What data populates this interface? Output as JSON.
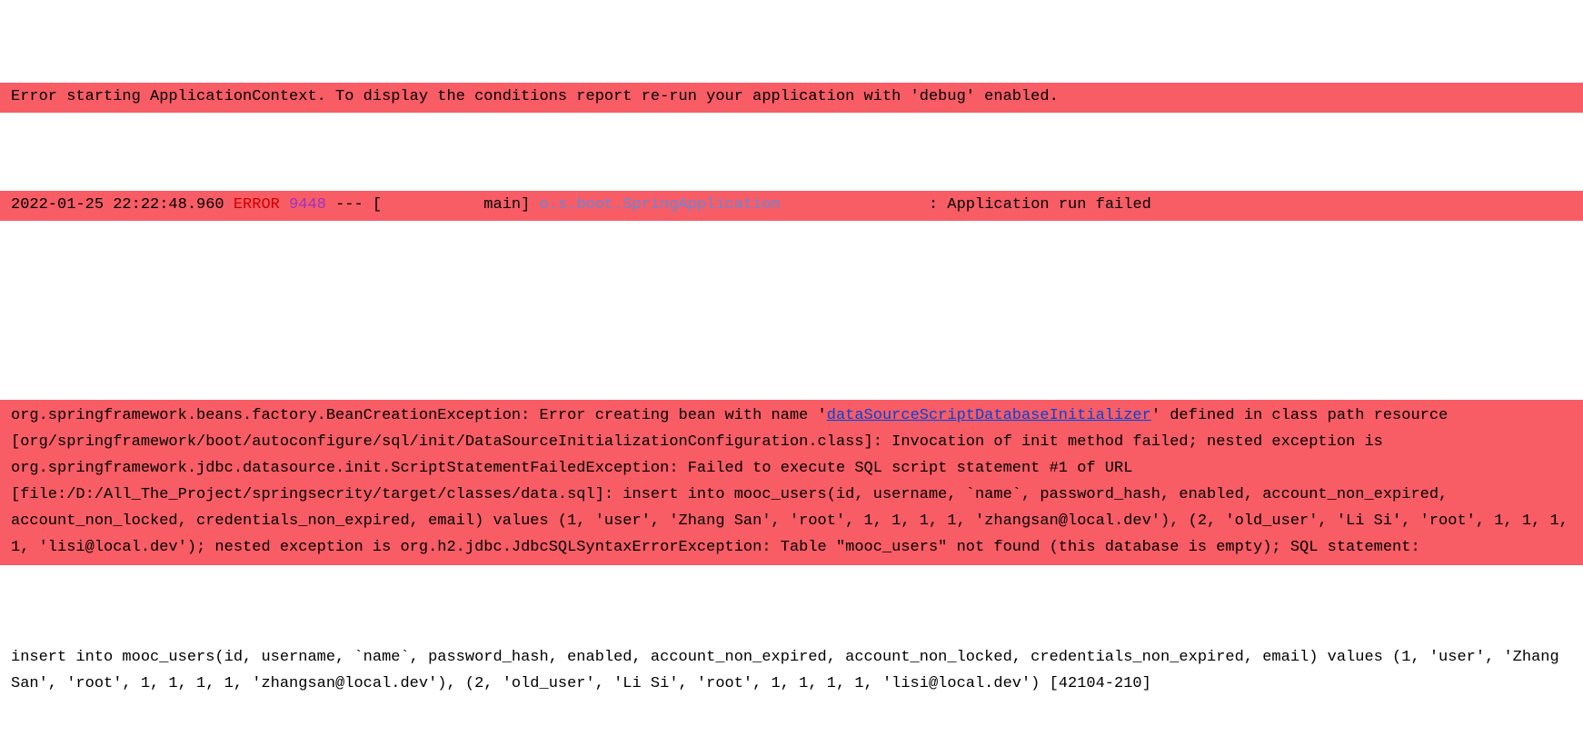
{
  "header": {
    "context_error": "Error starting ApplicationContext. To display the conditions report re-run your application with 'debug' enabled.",
    "timestamp": "2022-01-25 22:22:48.960",
    "level": "ERROR",
    "pid": "9448",
    "separator": " --- [           main] ",
    "logger": "o.s.boot.SpringApplication",
    "logger_padding": "               ",
    "message_prefix": " : ",
    "message": "Application run failed"
  },
  "exception": {
    "prefix1": "org.springframework.beans.factory.BeanCreationException: Error creating bean with name '",
    "link_text": "dataSourceScriptDatabaseInitializer",
    "body": "' defined in class path resource [org/springframework/boot/autoconfigure/sql/init/DataSourceInitializationConfiguration.class]: Invocation of init method failed; nested exception is org.springframework.jdbc.datasource.init.ScriptStatementFailedException: Failed to execute SQL script statement #1 of URL [file:/D:/All_The_Project/springsecrity/target/classes/data.sql]: insert into mooc_users(id, username, `name`, password_hash, enabled, account_non_expired, account_non_locked, credentials_non_expired, email) values (1, 'user', 'Zhang San', 'root', 1, 1, 1, 1, 'zhangsan@local.dev'), (2, 'old_user', 'Li Si', 'root', 1, 1, 1, 1, 'lisi@local.dev'); nested exception is org.h2.jdbc.JdbcSQLSyntaxErrorException: Table \"mooc_users\" not found (this database is empty); SQL statement:"
  },
  "sql_plain": "insert into mooc_users(id, username, `name`, password_hash, enabled, account_non_expired, account_non_locked, credentials_non_expired, email) values (1, 'user', 'Zhang San', 'root', 1, 1, 1, 1, 'zhangsan@local.dev'), (2, 'old_user', 'Li Si', 'root', 1, 1, 1, 1, 'lisi@local.dev') [42104-210]"
}
